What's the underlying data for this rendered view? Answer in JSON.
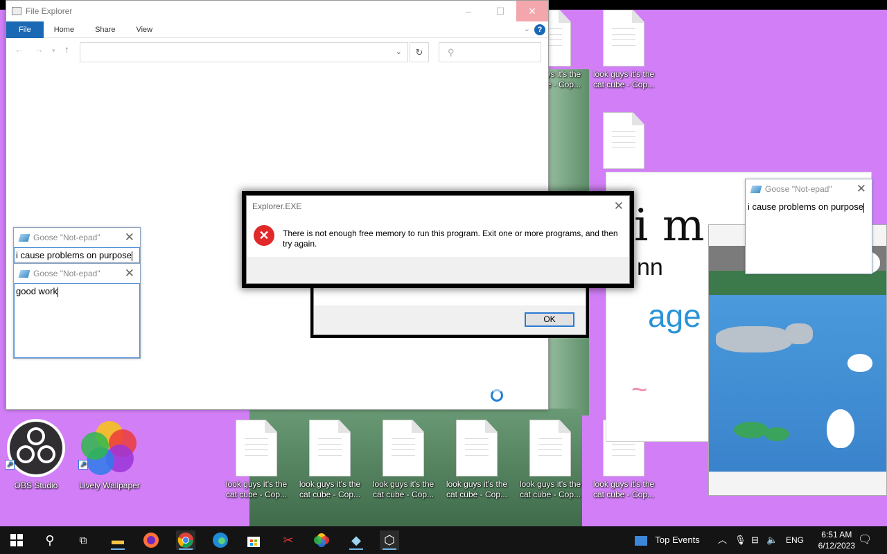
{
  "desktop": {
    "file_label": "look guys it's the cat cube - Cop...",
    "obs_label": "OBS Studio",
    "lively_label": "Lively Wallpaper"
  },
  "explorer": {
    "title": "File Explorer",
    "tabs": [
      "File",
      "Home",
      "Share",
      "View"
    ],
    "address_value": "",
    "search_placeholder": ""
  },
  "notes": [
    {
      "title": "Goose \"Not-epad\"",
      "text": "i cause problems on purpose"
    },
    {
      "title": "Goose \"Not-epad\"",
      "text": "good work"
    },
    {
      "title": "Goose \"Not-epad\"",
      "text": "i cause problems on purpose"
    }
  ],
  "dialog": {
    "title": "Explorer.EXE",
    "message": "There is not enough free memory to run this program. Exit one or more programs, and then try again.",
    "back_message_fragment": "one or more programs, and then try again.",
    "ok_label": "OK"
  },
  "whiteboard": {
    "scribble_1": "i m",
    "scribble_2": "nn",
    "scribble_3": "age",
    "scribble_4": "~"
  },
  "taskbar": {
    "widget_label": "Top Events",
    "language": "ENG",
    "time": "6:51 AM",
    "date": "6/12/2023"
  }
}
